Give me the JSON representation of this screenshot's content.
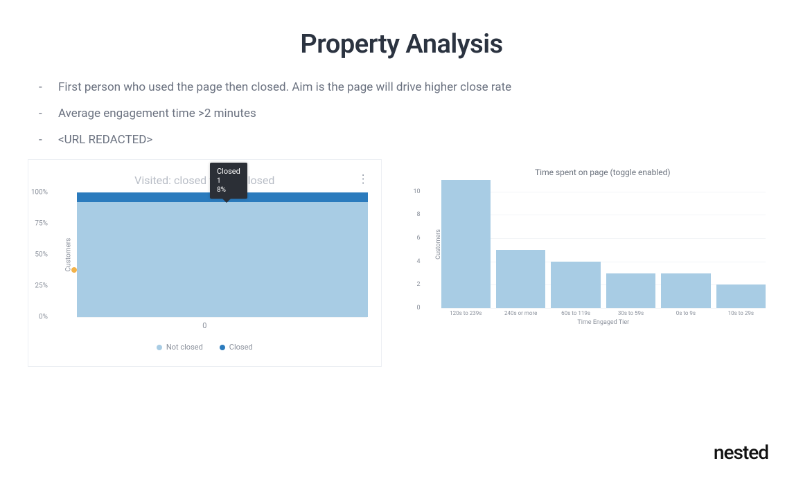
{
  "title": "Property Analysis",
  "bullets": [
    "First person who used the page then closed. Aim is the page will drive higher close rate",
    "Average engagement time >2 minutes",
    "<URL REDACTED>"
  ],
  "brand": "nested",
  "chart1": {
    "title": "Visited: closed vs not closed",
    "ylabel": "Customers",
    "yticks": [
      "0%",
      "25%",
      "50%",
      "75%",
      "100%"
    ],
    "xcategory": "0",
    "legend": {
      "not_closed": "Not closed",
      "closed": "Closed"
    },
    "tooltip": {
      "title": "Closed",
      "count": "1",
      "percent": "8%"
    },
    "menu_icon": "⋮"
  },
  "chart2": {
    "title": "Time spent on page (toggle enabled)",
    "ylabel": "Customers",
    "xlabel": "Time Engaged Tier",
    "yticks": [
      "0",
      "2",
      "4",
      "6",
      "8",
      "10"
    ]
  },
  "chart_data": [
    {
      "type": "bar",
      "stacked": true,
      "title": "Visited: closed vs not closed",
      "categories": [
        "0"
      ],
      "series": [
        {
          "name": "Not closed",
          "values": [
            92
          ],
          "color": "#a8cce4"
        },
        {
          "name": "Closed",
          "values": [
            8
          ],
          "color": "#2b7bbd"
        }
      ],
      "ylabel": "Customers",
      "ylim": [
        0,
        100
      ],
      "y_unit": "%",
      "tooltip": {
        "series": "Closed",
        "count": 1,
        "percent": "8%"
      }
    },
    {
      "type": "bar",
      "title": "Time spent on page (toggle enabled)",
      "categories": [
        "120s to 239s",
        "240s or more",
        "60s to 119s",
        "30s to 59s",
        "0s to 9s",
        "10s to 29s"
      ],
      "values": [
        11,
        5,
        4,
        3,
        3,
        2
      ],
      "xlabel": "Time Engaged Tier",
      "ylabel": "Customers",
      "ylim": [
        0,
        11
      ],
      "color": "#a8cce4"
    }
  ]
}
